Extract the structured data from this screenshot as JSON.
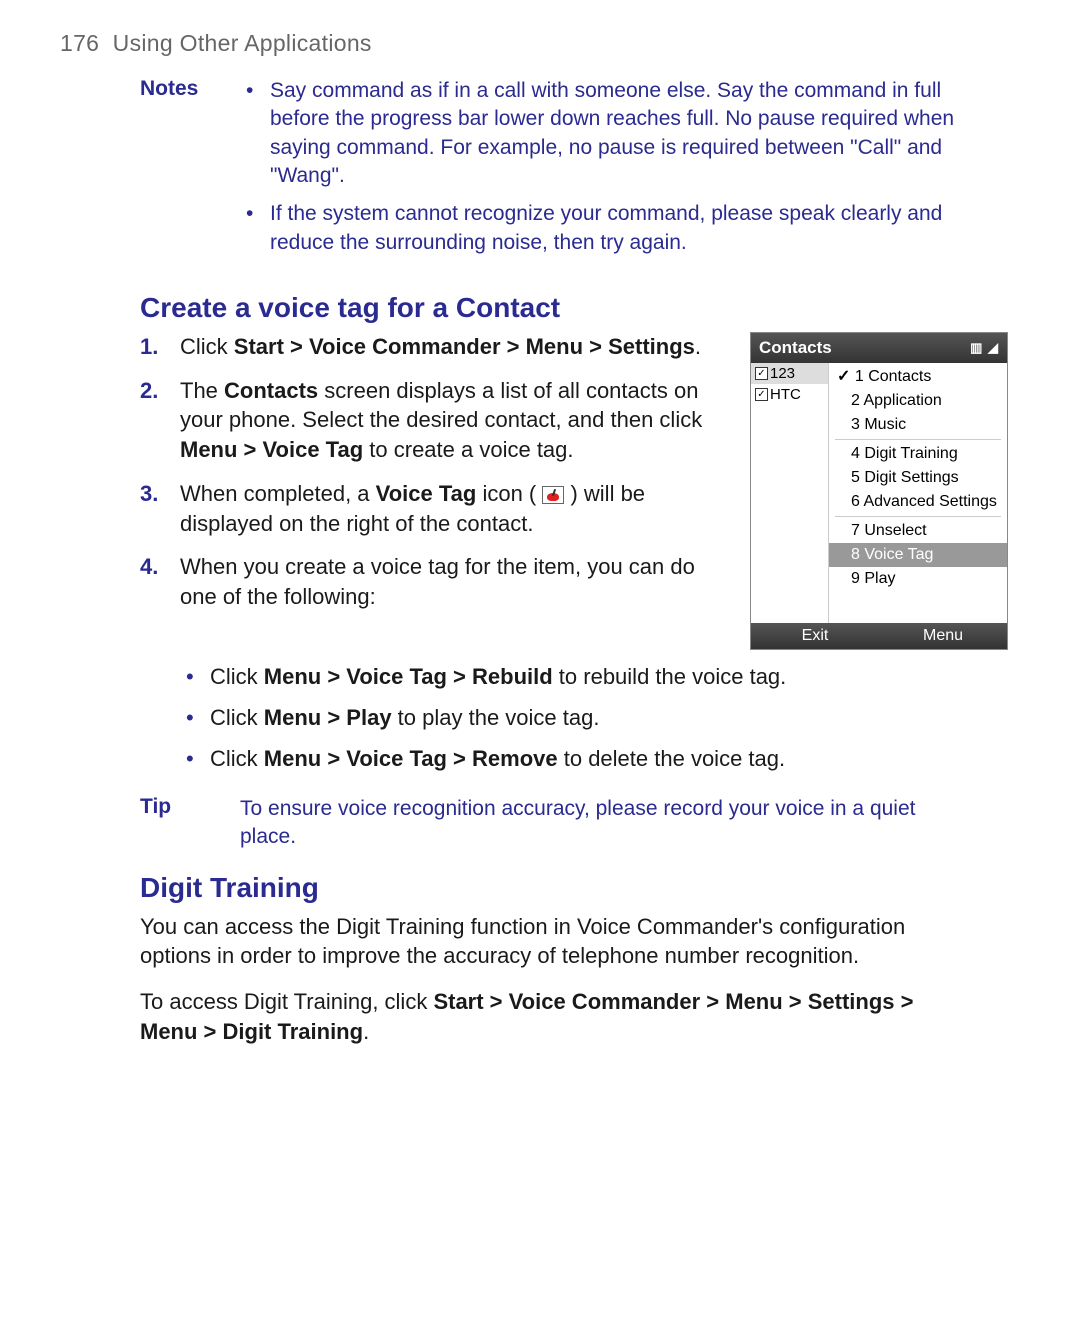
{
  "header": {
    "page_number": "176",
    "chapter": "Using Other Applications"
  },
  "notes": {
    "label": "Notes",
    "items": [
      "Say command as if in a call with someone else. Say the command in full before the progress bar lower down reaches full. No pause required when saying command. For example, no pause is required between \"Call\" and \"Wang\".",
      "If the system cannot recognize your command, please speak clearly and reduce the surrounding noise, then try again."
    ]
  },
  "section1": {
    "heading": "Create a voice tag for a Contact",
    "step1": {
      "pre": "Click ",
      "bold": "Start > Voice Commander > Menu > Settings",
      "post": "."
    },
    "step2": {
      "p1": "The ",
      "b1": "Contacts",
      "p2": " screen displays a list of all contacts on your phone. Select the desired contact, and then click ",
      "b2": "Menu > Voice Tag",
      "p3": " to create a voice tag."
    },
    "step3": {
      "p1": "When completed, a ",
      "b1": "Voice Tag",
      "p2": " icon ( ",
      "p3": " ) will be displayed on the right of the contact."
    },
    "step4": "When you create a voice tag for the item, you can do one of the following:",
    "subs": {
      "a": {
        "p1": "Click ",
        "b1": "Menu > Voice Tag > Rebuild",
        "p2": " to rebuild the voice tag."
      },
      "b": {
        "p1": "Click ",
        "b1": "Menu > Play",
        "p2": " to play the voice tag."
      },
      "c": {
        "p1": "Click ",
        "b1": "Menu > Voice Tag > Remove",
        "p2": " to delete the voice tag."
      }
    }
  },
  "tip": {
    "label": "Tip",
    "text": "To ensure voice recognition accuracy, please record your voice in a quiet place."
  },
  "section2": {
    "heading": "Digit Training",
    "para1": "You can access the Digit Training function in Voice Commander's configuration options in order to improve the accuracy of telephone number recognition.",
    "para2": {
      "p1": "To access Digit Training, click ",
      "b1": "Start > Voice Commander > Menu > Settings > Menu > Digit Training",
      "p2": "."
    }
  },
  "phone": {
    "title": "Contacts",
    "status": "▥ ◢",
    "left": {
      "item1": "123",
      "item2": "HTC"
    },
    "menu": {
      "i1": "1 Contacts",
      "i2": "2 Application",
      "i3": "3 Music",
      "i4": "4 Digit Training",
      "i5": "5 Digit Settings",
      "i6": "6 Advanced Settings",
      "i7": "7 Unselect",
      "i8": "8 Voice Tag",
      "i9": "9 Play"
    },
    "soft": {
      "left": "Exit",
      "right": "Menu"
    }
  }
}
